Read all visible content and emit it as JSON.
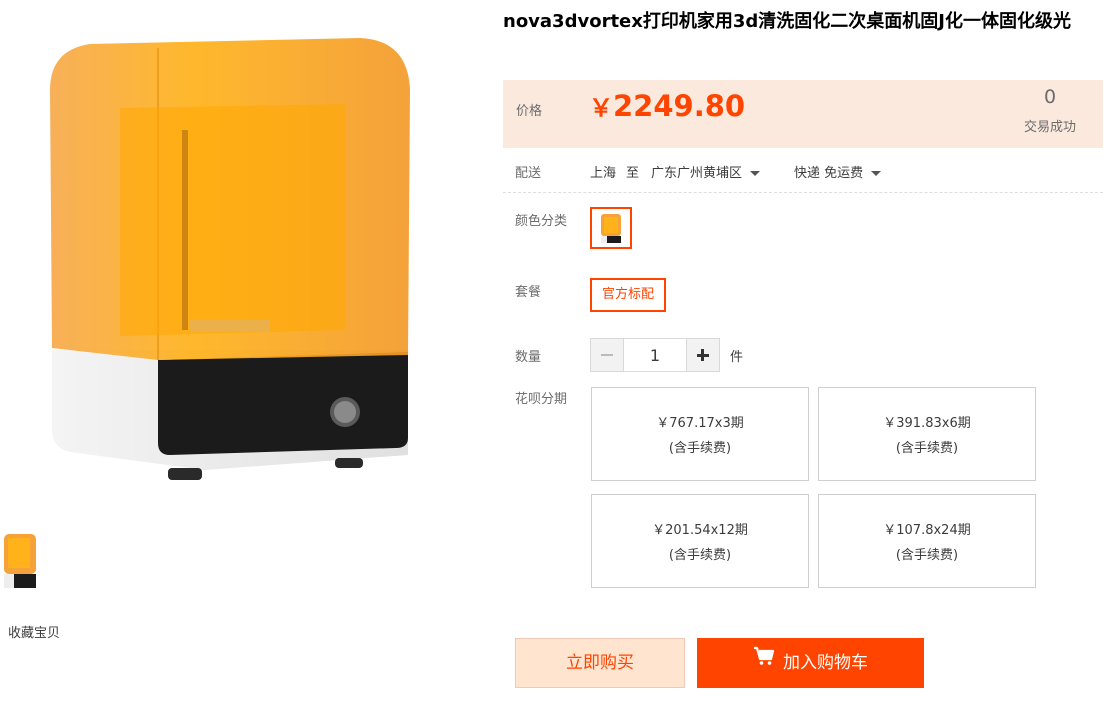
{
  "gallery": {
    "favorite_label": "收藏宝贝"
  },
  "product": {
    "title": "nova3dvortex打印机家用3d清洗固化二次桌面机固J化一体固化级光"
  },
  "price": {
    "label": "价格",
    "currency": "￥",
    "amount": "2249.80",
    "sold_count": "0",
    "sold_label": "交易成功",
    "accent_color": "#ff4400"
  },
  "shipping": {
    "label": "配送",
    "from": "上海",
    "to_word": "至",
    "destination": "广东广州黄埔区",
    "method": "快递 免运费"
  },
  "color": {
    "label": "颜色分类"
  },
  "package": {
    "label": "套餐",
    "option": "官方标配"
  },
  "quantity": {
    "label": "数量",
    "value": "1",
    "unit": "件"
  },
  "installments": {
    "label": "花呗分期",
    "options": [
      {
        "plan": "￥767.17x3期",
        "fee": "(含手续费)"
      },
      {
        "plan": "￥391.83x6期",
        "fee": "(含手续费)"
      },
      {
        "plan": "￥201.54x12期",
        "fee": "(含手续费)"
      },
      {
        "plan": "￥107.8x24期",
        "fee": "(含手续费)"
      }
    ]
  },
  "actions": {
    "buy_now": "立即购买",
    "add_to_cart": "加入购物车"
  }
}
